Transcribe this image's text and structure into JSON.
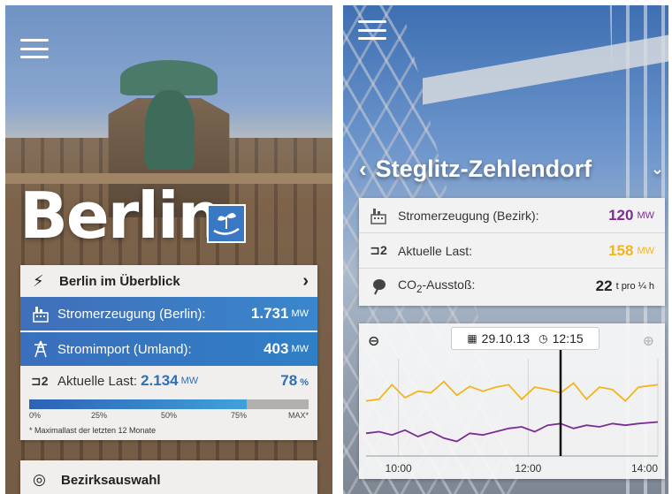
{
  "left_screen": {
    "city_title": "Berlin",
    "overview": {
      "title": "Berlin im Überblick",
      "rows": [
        {
          "label": "Stromerzeugung (Berlin):",
          "value": "1.731",
          "unit": "MW"
        },
        {
          "label": "Stromimport (Umland):",
          "value": "403",
          "unit": "MW"
        }
      ],
      "load": {
        "label": "Aktuelle Last:",
        "value": "2.134",
        "unit": "MW",
        "percent": "78",
        "percent_unit": "%",
        "fill_percent": 78
      },
      "scale_ticks": [
        "0%",
        "25%",
        "50%",
        "75%",
        "MAX*"
      ],
      "footnote": "* Maximallast der letzten 12 Monate"
    },
    "district_select": {
      "label": "Bezirksauswahl"
    }
  },
  "right_screen": {
    "district_name": "Steglitz-Zehlendorf",
    "stats": [
      {
        "label": "Stromerzeugung (Bezirk):",
        "value": "120",
        "unit": "MW",
        "color": "#7b2d95"
      },
      {
        "label": "Aktuelle Last:",
        "value": "158",
        "unit": "MW",
        "color": "#f2b51c"
      },
      {
        "label_prefix": "CO",
        "label_sub": "2",
        "label_suffix": "-Ausstoß:",
        "value": "22",
        "unit": "t pro ¼ h",
        "color": "#222222"
      }
    ],
    "chart": {
      "date": "29.10.13",
      "time": "12:15"
    }
  },
  "chart_data": {
    "type": "line",
    "title": "",
    "xlabel": "",
    "ylabel": "",
    "x_ticks": [
      "10:00",
      "12:00",
      "14:00"
    ],
    "x_range_hours": [
      9.5,
      14.0
    ],
    "y_range": [
      80,
      200
    ],
    "cursor_time_hours": 12.5,
    "x": [
      9.5,
      9.7,
      9.9,
      10.1,
      10.3,
      10.5,
      10.7,
      10.9,
      11.1,
      11.3,
      11.5,
      11.7,
      11.9,
      12.1,
      12.3,
      12.5,
      12.7,
      12.9,
      13.1,
      13.3,
      13.5,
      13.7,
      14.0
    ],
    "series": [
      {
        "color": "#f2b51c",
        "values": [
          148,
          150,
          168,
          152,
          160,
          158,
          172,
          155,
          166,
          160,
          165,
          168,
          150,
          165,
          162,
          158,
          170,
          150,
          165,
          162,
          148,
          165,
          168
        ]
      },
      {
        "color": "#7b2d95",
        "values": [
          108,
          110,
          106,
          112,
          104,
          110,
          102,
          98,
          108,
          106,
          110,
          114,
          116,
          110,
          118,
          120,
          114,
          118,
          116,
          120,
          118,
          120,
          122
        ]
      }
    ]
  },
  "icons": {
    "menu": "hamburger-icon",
    "bolt": "⚡",
    "chevron_right": "›",
    "chevron_left": "‹",
    "chevron_down": "⌄",
    "load": "⊐2",
    "district": "◎",
    "zoom_out": "⊖",
    "zoom_in": "⊕",
    "calendar": "▦",
    "clock": "◷"
  }
}
